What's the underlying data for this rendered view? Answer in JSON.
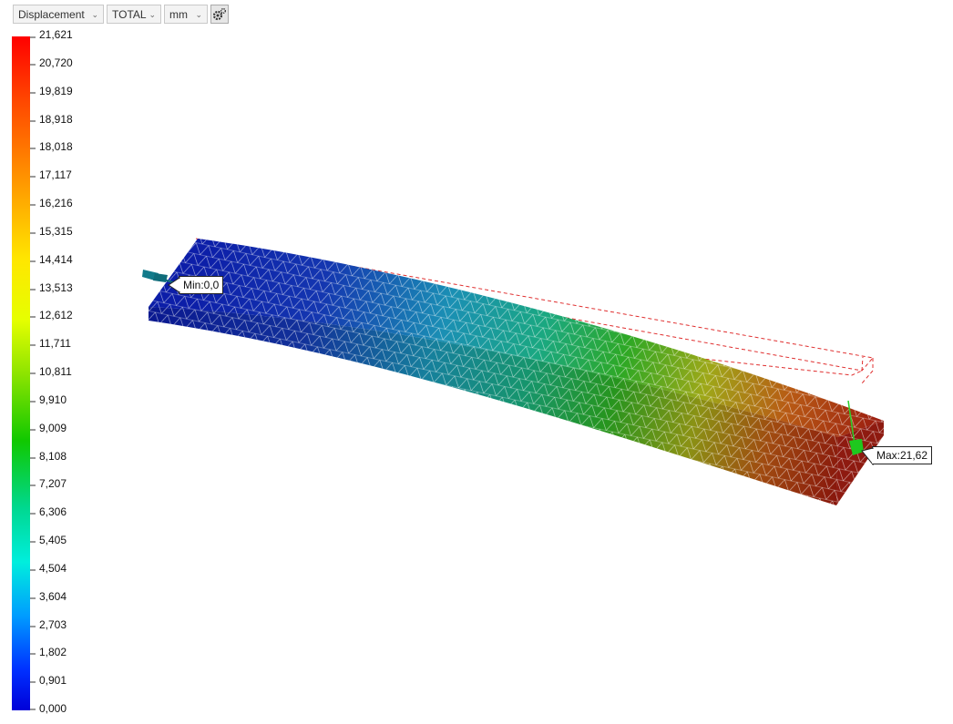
{
  "toolbar": {
    "result_type": "Displacement",
    "component": "TOTAL",
    "unit": "mm",
    "settings_icon": "gear-icon"
  },
  "legend": {
    "labels": [
      "21,621",
      "20,720",
      "19,819",
      "18,918",
      "18,018",
      "17,117",
      "16,216",
      "15,315",
      "14,414",
      "13,513",
      "12,612",
      "11,711",
      "10,811",
      "9,910",
      "9,009",
      "8,108",
      "7,207",
      "6,306",
      "5,405",
      "4,504",
      "3,604",
      "2,703",
      "1,802",
      "0,901",
      "0,000"
    ],
    "colors": [
      "#ff0000",
      "#ff2600",
      "#ff4a00",
      "#ff6a00",
      "#ff8a00",
      "#ffa800",
      "#ffc600",
      "#ffe000",
      "#fff200",
      "#f3ff00",
      "#d8ff00",
      "#aef000",
      "#7ee000",
      "#4fd200",
      "#21c800",
      "#00c83a",
      "#00cf76",
      "#00dcae",
      "#00e8dc",
      "#00cfff",
      "#009cff",
      "#0068ff",
      "#0036ff",
      "#0010f0",
      "#0000dc"
    ]
  },
  "markers": {
    "min_label": "Min:0,0",
    "max_label": "Max:21,62"
  }
}
